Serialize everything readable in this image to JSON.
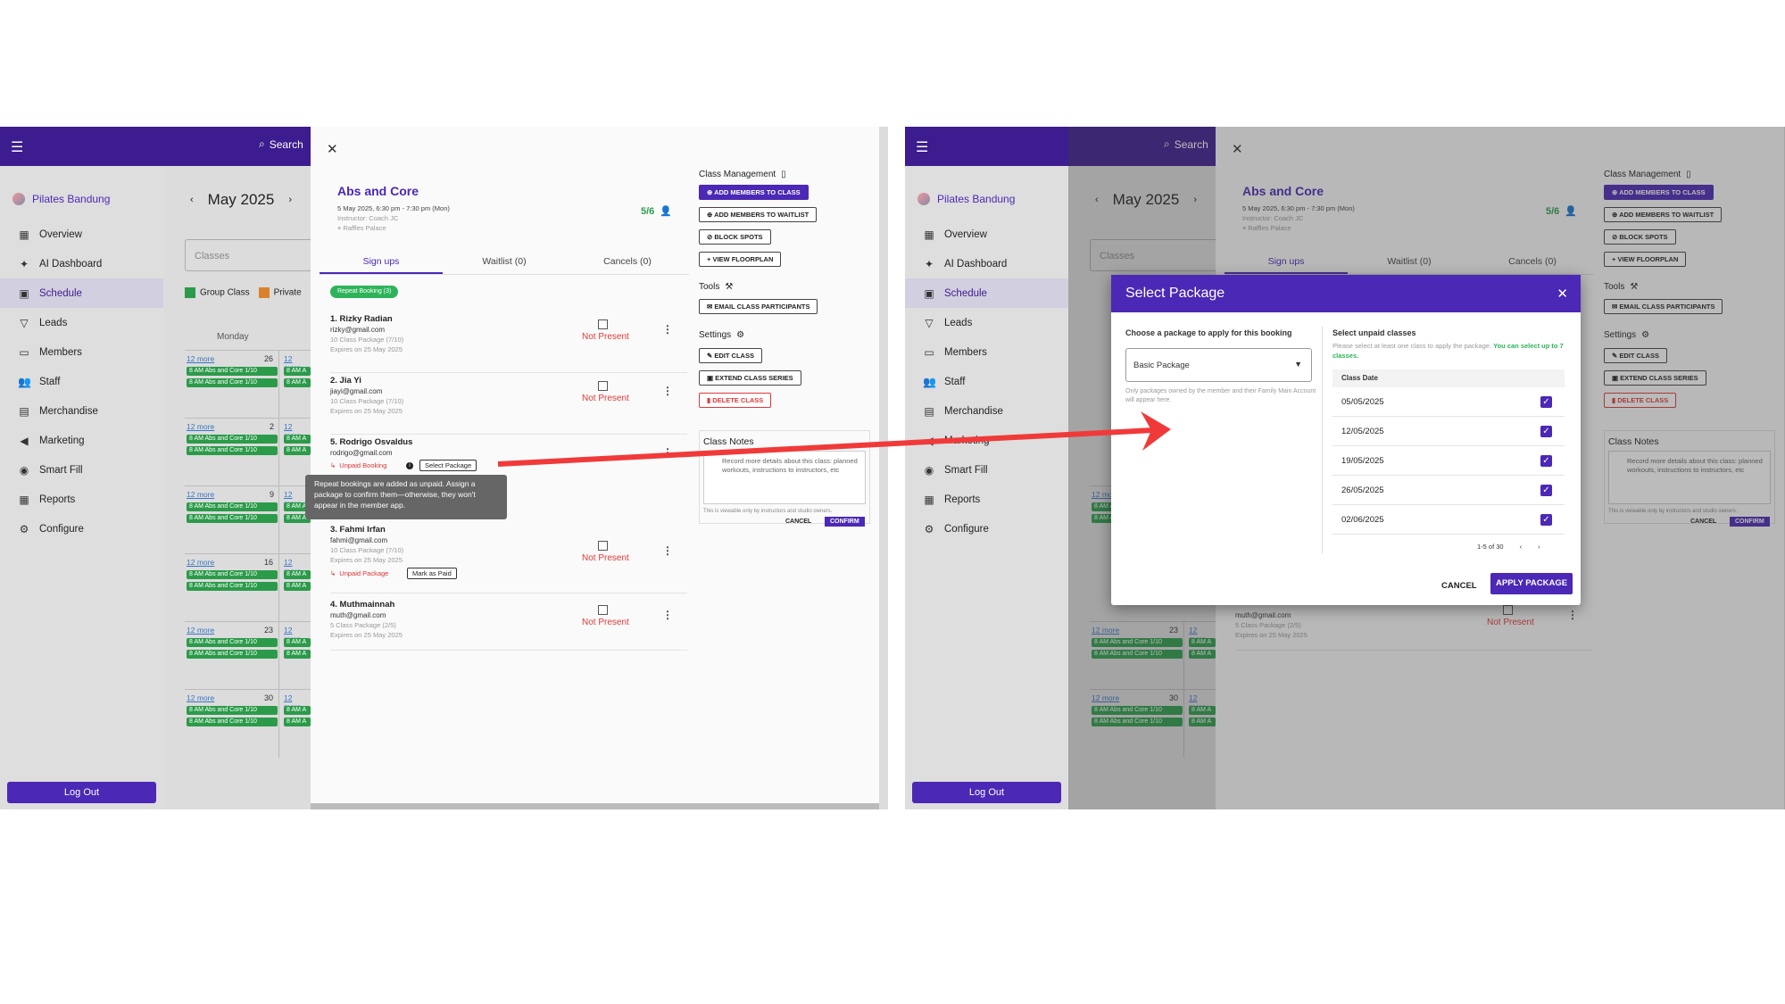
{
  "app": {
    "search_label": "Search",
    "brand": "Pilates Bandung",
    "nav": [
      {
        "label": "Overview",
        "icon": "grid-icon"
      },
      {
        "label": "AI Dashboard",
        "icon": "sparkle-icon"
      },
      {
        "label": "Schedule",
        "icon": "calendar-icon"
      },
      {
        "label": "Leads",
        "icon": "funnel-icon"
      },
      {
        "label": "Members",
        "icon": "card-icon"
      },
      {
        "label": "Staff",
        "icon": "people-icon"
      },
      {
        "label": "Merchandise",
        "icon": "store-icon"
      },
      {
        "label": "Marketing",
        "icon": "megaphone-icon"
      },
      {
        "label": "Smart Fill",
        "icon": "brain-icon"
      },
      {
        "label": "Reports",
        "icon": "table-icon"
      },
      {
        "label": "Configure",
        "icon": "gear-icon"
      }
    ],
    "logout": "Log Out"
  },
  "calendar": {
    "month": "May 2025",
    "classes_placeholder": "Classes",
    "legend_group": "Group Class",
    "legend_private": "Private",
    "day_header": "Monday",
    "more": "12 more",
    "event": "8 AM Abs and Core 1/10",
    "event_short": "8 AM A",
    "day_numbers": [
      "26",
      "2",
      "9",
      "16",
      "23",
      "30"
    ]
  },
  "class": {
    "title": "Abs and Core",
    "datetime": "5 May 2025, 6:30 pm - 7:30 pm (Mon)",
    "instructor": "Instructor: Coach JC",
    "location": "Raffles Palace",
    "count": "5/6",
    "tabs": [
      "Sign ups",
      "Waitlist (0)",
      "Cancels (0)"
    ],
    "repeat_badge": "Repeat Booking (3)",
    "signups": [
      {
        "name": "1. Rizky Radian",
        "email": "rizky@gmail.com",
        "pkg": "10 Class Package (7/10)",
        "exp": "Expires on 25 May 2025",
        "status": "Not Present"
      },
      {
        "name": "2. Jia Yi",
        "email": "jiayi@gmail.com",
        "pkg": "10 Class Package (7/10)",
        "exp": "Expires on 25 May 2025",
        "status": "Not Present"
      },
      {
        "name": "5. Rodrigo Osvaldus",
        "email": "rodrigo@gmail.com",
        "unpaid": "Unpaid Booking",
        "action": "Select Package"
      },
      {
        "name": "3. Fahmi Irfan",
        "email": "fahmi@gmail.com",
        "pkg": "10 Class Package (7/10)",
        "exp": "Expires on 25 May 2025",
        "status": "Not Present",
        "unpaid": "Unpaid Package",
        "action": "Mark as Paid"
      },
      {
        "name": "4. Muthmainnah",
        "email": "muth@gmail.com",
        "pkg": "5 Class Package (2/5)",
        "exp": "Expires on 25 May 2025",
        "status": "Not Present"
      }
    ],
    "tooltip": "Repeat bookings are added as unpaid. Assign a package to confirm them—otherwise, they won't appear in the member app."
  },
  "management": {
    "class_management": "Class Management",
    "add_members": "ADD MEMBERS TO CLASS",
    "add_waitlist": "ADD MEMBERS TO WAITLIST",
    "block_spots": "BLOCK SPOTS",
    "view_floorplan": "VIEW FLOORPLAN",
    "tools": "Tools",
    "email_participants": "EMAIL CLASS PARTICIPANTS",
    "settings": "Settings",
    "edit_class": "EDIT CLASS",
    "extend_series": "EXTEND CLASS SERIES",
    "delete_class": "DELETE CLASS",
    "notes_title": "Class Notes",
    "notes_placeholder": "Record more details about this class: planned workouts, instructions to instructors, etc",
    "notes_hint": "This is viewable only by instructors and studio owners.",
    "notes_cancel": "CANCEL",
    "notes_confirm": "CONFIRM"
  },
  "dialog": {
    "title": "Select Package",
    "choose_label": "Choose a package to apply for this booking",
    "selected_package": "Basic Package",
    "choose_help": "Only packages owned by the member and their Family Main Account will appear here.",
    "unpaid_label": "Select unpaid classes",
    "unpaid_help": "Please select at least one class to apply the package.",
    "unpaid_limit": "You can select up to 7 classes.",
    "col_header": "Class Date",
    "dates": [
      "05/05/2025",
      "12/05/2025",
      "19/05/2025",
      "26/05/2025",
      "02/06/2025"
    ],
    "pager": "1-5 of 30",
    "cancel": "CANCEL",
    "apply": "APPLY PACKAGE"
  },
  "colors": {
    "primary": "#4b28b5",
    "success": "#2eb35a",
    "danger": "#e03a3a",
    "arrow": "#f03a3a"
  }
}
